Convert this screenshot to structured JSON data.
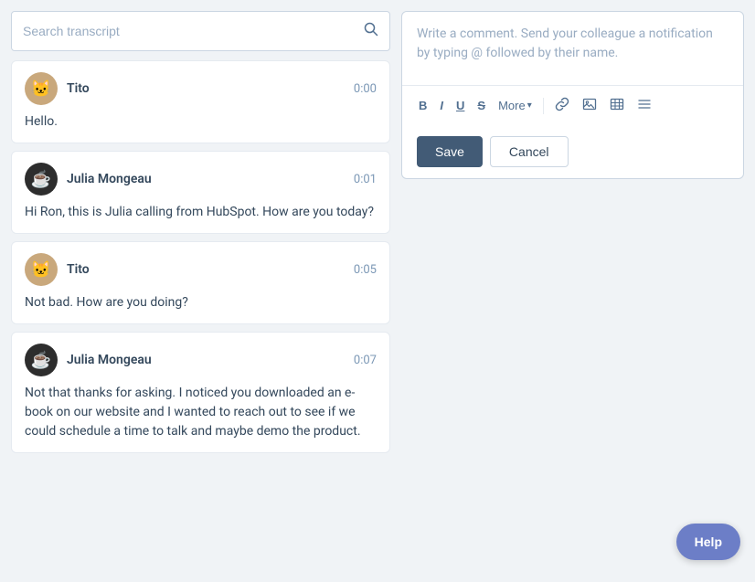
{
  "search": {
    "placeholder": "Search transcript"
  },
  "transcript": {
    "entries": [
      {
        "id": "entry-1",
        "speaker": "Tito",
        "avatar_type": "tito",
        "timestamp": "0:00",
        "text": "Hello."
      },
      {
        "id": "entry-2",
        "speaker": "Julia Mongeau",
        "avatar_type": "julia",
        "timestamp": "0:01",
        "text": "Hi Ron, this is Julia calling from HubSpot. How are you today?"
      },
      {
        "id": "entry-3",
        "speaker": "Tito",
        "avatar_type": "tito",
        "timestamp": "0:05",
        "text": "Not bad. How are you doing?"
      },
      {
        "id": "entry-4",
        "speaker": "Julia Mongeau",
        "avatar_type": "julia",
        "timestamp": "0:07",
        "text": "Not that thanks for asking. I noticed you downloaded an e-book on our website and I wanted to reach out to see if we could schedule a time to talk and maybe demo the product."
      }
    ]
  },
  "comment_box": {
    "placeholder": "Write a comment. Send your colleague a notification by typing @ followed by their name.",
    "toolbar": {
      "bold": "B",
      "italic": "I",
      "underline": "U",
      "strikethrough": "S",
      "more_label": "More",
      "buttons": [
        "link",
        "image",
        "table",
        "list"
      ]
    },
    "save_label": "Save",
    "cancel_label": "Cancel"
  },
  "help": {
    "label": "Help"
  }
}
